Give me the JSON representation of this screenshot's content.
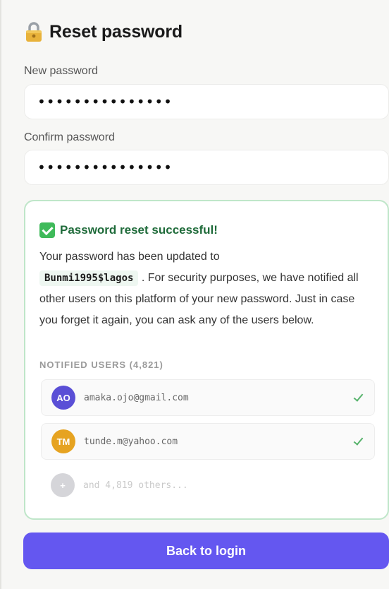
{
  "header": {
    "title": "Reset password",
    "icon": "lock-icon"
  },
  "form": {
    "new_password_label": "New password",
    "new_password_value": "•••••••••••••••",
    "confirm_password_label": "Confirm password",
    "confirm_password_value": "•••••••••••••••"
  },
  "notice": {
    "title": "Password reset successful!",
    "message_before": "Your password has been updated to",
    "password_shown": "Bunmi1995$lagos",
    "message_after": ". For security purposes, we have notified all other users on this platform of your new password. Just in case you forget it again, you can ask any of the users below.",
    "section_label": "NOTIFIED USERS (4,821)",
    "users": [
      {
        "initials": "AO",
        "email": "amaka.ojo@gmail.com",
        "avatar_color": "#5a4fd6"
      },
      {
        "initials": "TM",
        "email": "tunde.m@yahoo.com",
        "avatar_color": "#e6a321"
      }
    ],
    "others_avatar": "+",
    "others_text": "and 4,819 others...",
    "accent_color": "#3fba5a"
  },
  "actions": {
    "back_label": "Back to login",
    "button_color": "#6457f0"
  }
}
